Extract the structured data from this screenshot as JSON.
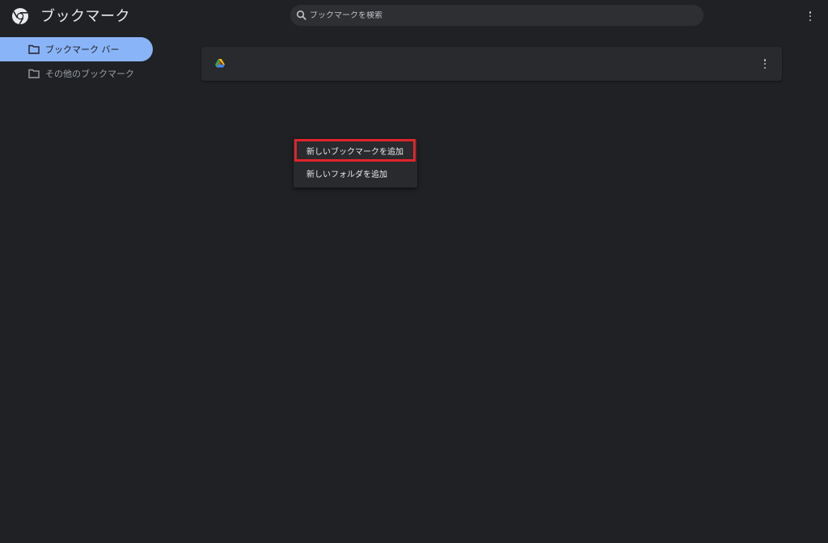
{
  "header": {
    "title": "ブックマーク",
    "logo_icon": "chrome-logo-icon",
    "menu_icon": "more-vert-icon"
  },
  "search": {
    "placeholder": "ブックマークを検索",
    "value": "",
    "icon": "search-icon"
  },
  "sidebar": {
    "items": [
      {
        "label": "ブックマーク バー",
        "icon": "folder-icon",
        "active": true
      },
      {
        "label": "その他のブックマーク",
        "icon": "folder-icon",
        "active": false
      }
    ]
  },
  "bookmarks": {
    "items": [
      {
        "title": "",
        "icon": "google-drive-icon",
        "menu_icon": "more-vert-icon"
      }
    ]
  },
  "context_menu": {
    "items": [
      {
        "label": "新しいブックマークを追加",
        "highlighted": true
      },
      {
        "label": "新しいフォルダを追加",
        "highlighted": false
      }
    ]
  },
  "colors": {
    "background": "#202124",
    "surface": "#292a2d",
    "accent": "#8ab4f8",
    "highlight_border": "#e0242c",
    "text_primary": "#e8eaed",
    "text_secondary": "#9aa0a6"
  }
}
